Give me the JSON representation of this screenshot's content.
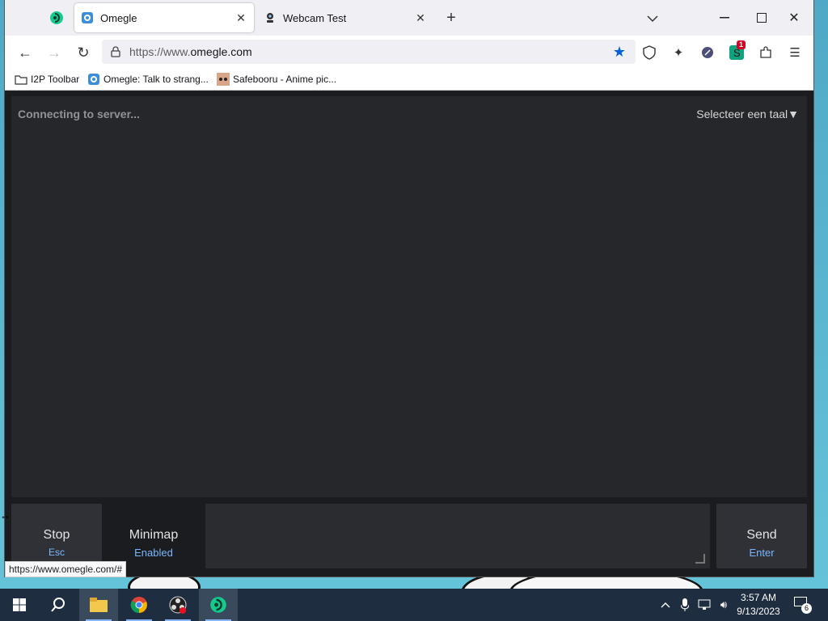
{
  "browser": {
    "tabs": [
      {
        "title": "Omegle",
        "active": true
      },
      {
        "title": "Webcam Test",
        "active": false
      }
    ],
    "url_prefix": "https://www.",
    "url_domain": "omegle.com",
    "bookmarks": [
      {
        "label": "I2P Toolbar",
        "icon": "folder-icon"
      },
      {
        "label": "Omegle: Talk to strang...",
        "icon": "omegle-icon"
      },
      {
        "label": "Safebooru - Anime pic...",
        "icon": "safebooru-icon"
      }
    ],
    "extension_badge": "1",
    "status_url": "https://www.omegle.com/#"
  },
  "page": {
    "status": "Connecting to server...",
    "language_selector": "Selecteer een taal▼",
    "stop": {
      "label": "Stop",
      "hint": "Esc"
    },
    "minimap": {
      "label": "Minimap",
      "state": "Enabled"
    },
    "send": {
      "label": "Send",
      "hint": "Enter"
    },
    "message_value": ""
  },
  "taskbar": {
    "time": "3:57 AM",
    "date": "9/13/2023",
    "notification_count": "6"
  },
  "colors": {
    "accent_blue": "#7ab6ff",
    "star_blue": "#0060df",
    "badge_red": "#d70022"
  }
}
